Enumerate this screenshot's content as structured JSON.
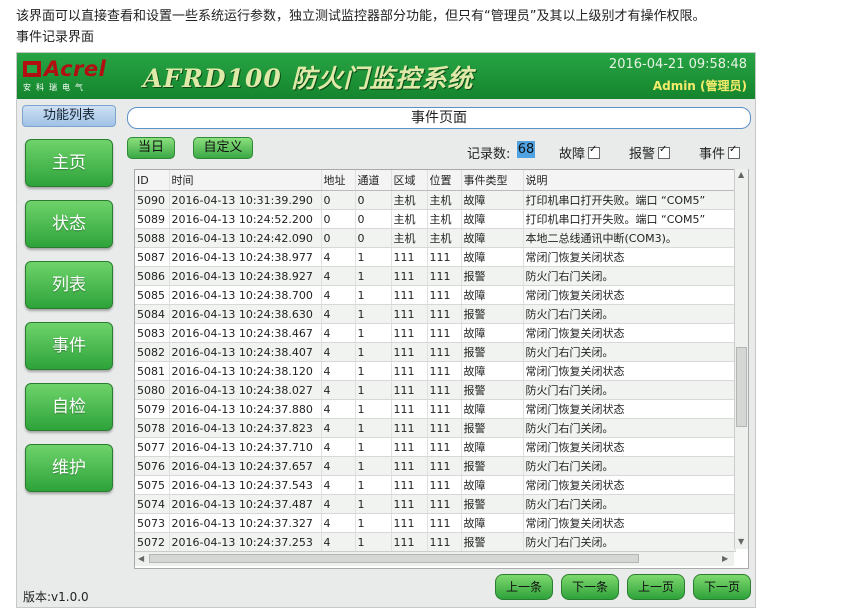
{
  "intro": {
    "line1": "该界面可以直接查看和设置一些系统运行参数，独立测试监控器部分功能，但只有“管理员”及其以上级别才有操作权限。",
    "line2": "事件记录界面"
  },
  "header": {
    "logo_text": "Acrel",
    "logo_sub": "安科瑞电气",
    "app_title": "AFRD100 防火门监控系统",
    "datetime": "2016-04-21 09:58:48",
    "user": "Admin (管理员)"
  },
  "sidebar": {
    "title": "功能列表",
    "items": [
      {
        "label": "主页"
      },
      {
        "label": "状态"
      },
      {
        "label": "列表"
      },
      {
        "label": "事件"
      },
      {
        "label": "自检"
      },
      {
        "label": "维护"
      }
    ],
    "version": "版本:v1.0.0"
  },
  "main": {
    "page_title": "事件页面",
    "today_button": "当日",
    "custom_button": "自定义",
    "count_label": "记录数:",
    "count_value": "68",
    "filters": [
      {
        "label": "故障",
        "checked": true
      },
      {
        "label": "报警",
        "checked": true
      },
      {
        "label": "事件",
        "checked": true
      }
    ]
  },
  "table": {
    "columns": [
      "ID",
      "时间",
      "地址",
      "通道",
      "区域",
      "位置",
      "事件类型",
      "说明"
    ],
    "rows": [
      [
        "5090",
        "2016-04-13 10:31:39.290",
        "0",
        "0",
        "主机",
        "主机",
        "故障",
        "打印机串口打开失败。端口 “COM5”"
      ],
      [
        "5089",
        "2016-04-13 10:24:52.200",
        "0",
        "0",
        "主机",
        "主机",
        "故障",
        "打印机串口打开失败。端口 “COM5”"
      ],
      [
        "5088",
        "2016-04-13 10:24:42.090",
        "0",
        "0",
        "主机",
        "主机",
        "故障",
        "本地二总线通讯中断(COM3)。"
      ],
      [
        "5087",
        "2016-04-13 10:24:38.977",
        "4",
        "1",
        "111",
        "111",
        "故障",
        "常闭门恢复关闭状态"
      ],
      [
        "5086",
        "2016-04-13 10:24:38.927",
        "4",
        "1",
        "111",
        "111",
        "报警",
        "防火门右门关闭。"
      ],
      [
        "5085",
        "2016-04-13 10:24:38.700",
        "4",
        "1",
        "111",
        "111",
        "故障",
        "常闭门恢复关闭状态"
      ],
      [
        "5084",
        "2016-04-13 10:24:38.630",
        "4",
        "1",
        "111",
        "111",
        "报警",
        "防火门右门关闭。"
      ],
      [
        "5083",
        "2016-04-13 10:24:38.467",
        "4",
        "1",
        "111",
        "111",
        "故障",
        "常闭门恢复关闭状态"
      ],
      [
        "5082",
        "2016-04-13 10:24:38.407",
        "4",
        "1",
        "111",
        "111",
        "报警",
        "防火门右门关闭。"
      ],
      [
        "5081",
        "2016-04-13 10:24:38.120",
        "4",
        "1",
        "111",
        "111",
        "故障",
        "常闭门恢复关闭状态"
      ],
      [
        "5080",
        "2016-04-13 10:24:38.027",
        "4",
        "1",
        "111",
        "111",
        "报警",
        "防火门右门关闭。"
      ],
      [
        "5079",
        "2016-04-13 10:24:37.880",
        "4",
        "1",
        "111",
        "111",
        "故障",
        "常闭门恢复关闭状态"
      ],
      [
        "5078",
        "2016-04-13 10:24:37.823",
        "4",
        "1",
        "111",
        "111",
        "报警",
        "防火门右门关闭。"
      ],
      [
        "5077",
        "2016-04-13 10:24:37.710",
        "4",
        "1",
        "111",
        "111",
        "故障",
        "常闭门恢复关闭状态"
      ],
      [
        "5076",
        "2016-04-13 10:24:37.657",
        "4",
        "1",
        "111",
        "111",
        "报警",
        "防火门右门关闭。"
      ],
      [
        "5075",
        "2016-04-13 10:24:37.543",
        "4",
        "1",
        "111",
        "111",
        "故障",
        "常闭门恢复关闭状态"
      ],
      [
        "5074",
        "2016-04-13 10:24:37.487",
        "4",
        "1",
        "111",
        "111",
        "报警",
        "防火门右门关闭。"
      ],
      [
        "5073",
        "2016-04-13 10:24:37.327",
        "4",
        "1",
        "111",
        "111",
        "故障",
        "常闭门恢复关闭状态"
      ],
      [
        "5072",
        "2016-04-13 10:24:37.253",
        "4",
        "1",
        "111",
        "111",
        "报警",
        "防火门右门关闭。"
      ]
    ]
  },
  "pager": {
    "prev_item": "上一条",
    "next_item": "下一条",
    "prev_page": "上一页",
    "next_page": "下一页"
  },
  "icons": {
    "checkbox": "checkmark-icon",
    "scroll_left": "scroll-left-arrow-icon",
    "scroll_right": "scroll-right-arrow-icon",
    "scroll_up": "scroll-up-arrow-icon",
    "scroll_down": "scroll-down-arrow-icon"
  },
  "colors": {
    "header_green": "#1f9a3a",
    "nav_button_green": "#3cb24a",
    "count_highlight": "#4fa3e3",
    "title_border": "#5c90c9"
  }
}
